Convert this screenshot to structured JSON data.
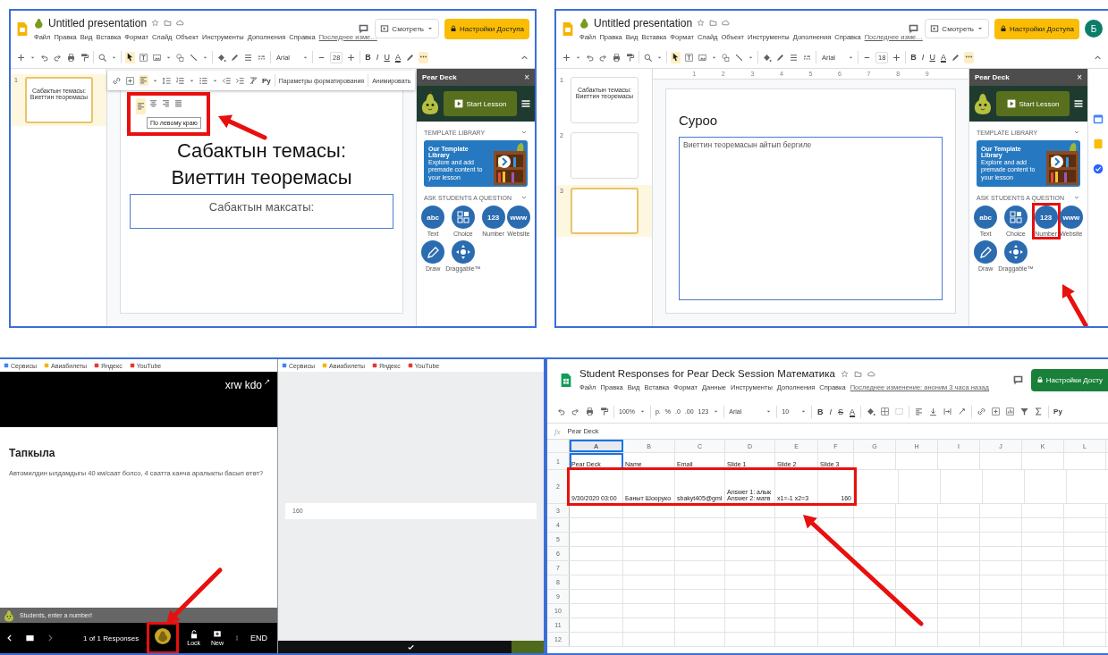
{
  "panels": [
    {
      "kind": "slides",
      "title": "Untitled presentation",
      "menu": [
        "Файл",
        "Правка",
        "Вид",
        "Вставка",
        "Формат",
        "Слайд",
        "Объект",
        "Инструменты",
        "Дополнения",
        "Справка"
      ],
      "last_edit": "Последнее изме…",
      "present_button": "Смотреть",
      "share_button": "Настройки Доступа",
      "font": "Arial",
      "font_size": "28",
      "format_buttons": [
        "B",
        "I",
        "U",
        "A"
      ],
      "format_bar": {
        "input_tools": "Py",
        "options": "Параметры форматирования",
        "animate": "Анимировать"
      },
      "align_menu": {
        "tooltip": "По левому краю",
        "highlighted": true
      },
      "addon_strip": false,
      "thumbnails": [
        {
          "number": "1",
          "text": "Сабактын темасы:\nВиеттин теоремасы",
          "selected": true
        }
      ],
      "slide": {
        "kind": "title",
        "title": "Сабактын темасы:\nВиеттин теоремасы",
        "body": "Сабактын максаты:"
      },
      "peardeck": {
        "title": "Pear Deck",
        "close": "×",
        "start": "Start Lesson",
        "library_heading": "TEMPLATE LIBRARY",
        "library_title": "Our Template Library",
        "library_text": "Explore and add premade content to your lesson",
        "ask_heading": "ASK STUDENTS A QUESTION",
        "question_types": [
          {
            "kind": "glyph",
            "glyph": "abc",
            "label": "Text",
            "highlighted": false
          },
          {
            "kind": "grid",
            "label": "Choice",
            "highlighted": false
          },
          {
            "kind": "glyph",
            "glyph": "123",
            "label": "Number",
            "highlighted": false
          },
          {
            "kind": "glyph",
            "glyph": "www",
            "label": "Website",
            "highlighted": false
          },
          {
            "kind": "pencil",
            "label": "Draw",
            "highlighted": false
          },
          {
            "kind": "move",
            "label": "Draggable™",
            "highlighted": false
          }
        ]
      }
    },
    {
      "kind": "slides",
      "title": "Untitled presentation",
      "menu": [
        "Файл",
        "Правка",
        "Вид",
        "Вставка",
        "Формат",
        "Слайд",
        "Объект",
        "Инструменты",
        "Дополнения",
        "Справка"
      ],
      "last_edit": "Последнее изме…",
      "present_button": "Смотреть",
      "share_button": "Настройки Доступа",
      "avatar": "Б",
      "font": "Arial",
      "font_size": "18",
      "format_buttons": [
        "B",
        "I",
        "U",
        "A"
      ],
      "ruler": [
        "1",
        "2",
        "3",
        "4",
        "5",
        "6",
        "7",
        "8",
        "9"
      ],
      "addon_strip": true,
      "thumbnails": [
        {
          "number": "1",
          "text": "Сабактын темасы:\nВиеттин теоремасы",
          "selected": false
        },
        {
          "number": "2",
          "selected": false
        },
        {
          "number": "3",
          "selected": true
        }
      ],
      "slide": {
        "kind": "question",
        "title": "Суроо",
        "body": "Виеттин теоремасын айтып бергиле"
      },
      "peardeck": {
        "title": "Pear Deck",
        "close": "×",
        "start": "Start Lesson",
        "library_heading": "TEMPLATE LIBRARY",
        "library_title": "Our Template Library",
        "library_text": "Explore and add premade content to your lesson",
        "ask_heading": "ASK STUDENTS A QUESTION",
        "question_types": [
          {
            "kind": "glyph",
            "glyph": "abc",
            "label": "Text",
            "highlighted": false
          },
          {
            "kind": "grid",
            "label": "Choice",
            "highlighted": false
          },
          {
            "kind": "glyph",
            "glyph": "123",
            "label": "Number",
            "highlighted": true
          },
          {
            "kind": "glyph",
            "glyph": "www",
            "label": "Website",
            "highlighted": false
          },
          {
            "kind": "pencil",
            "label": "Draw",
            "highlighted": false
          },
          {
            "kind": "move",
            "label": "Draggable™",
            "highlighted": false
          }
        ]
      }
    },
    {
      "kind": "presenter",
      "bookmarks": [
        "Сервисы",
        "Авиабилеты",
        "Яндекс",
        "YouTube"
      ],
      "session_code": "xrw kdo",
      "slide_title": "Тапкыла",
      "question": "Автомилдин ылдамдыгы 40 км/саат болсо, 4 саатта канча аралыкты басып өтөт?",
      "prompt_bar": "Students, enter a number!",
      "responses": "1 of 1 Responses",
      "deck_button_highlighted": true,
      "lock": "Lock",
      "new": "New",
      "end": "END",
      "student_bookmarks": [
        "Сервисы",
        "Авиабилеты",
        "Яндекс",
        "YouTube"
      ],
      "student_answer": "160"
    },
    {
      "kind": "sheet",
      "title": "Student Responses for Pear Deck Session Математика",
      "menu": [
        "Файл",
        "Правка",
        "Вид",
        "Вставка",
        "Формат",
        "Данные",
        "Инструменты",
        "Дополнения",
        "Справка"
      ],
      "last_edit": "Последнее изменение: аноним 3 часа назад",
      "share_button": "Настройки Досту",
      "toolbar": {
        "zoom": "100%",
        "number_formats": [
          "р.",
          "%",
          ".0",
          ".00",
          "123"
        ],
        "font": "Arial",
        "font_size": "10",
        "format_buttons": [
          "B",
          "I",
          "S",
          "A"
        ],
        "input_tools": "Py"
      },
      "formula_label": "fx",
      "formula": "Pear Deck",
      "columns": [
        {
          "label": "A",
          "selected": true
        },
        {
          "label": "B",
          "selected": false
        },
        {
          "label": "C",
          "selected": false
        },
        {
          "label": "D",
          "selected": false
        },
        {
          "label": "E",
          "selected": false
        },
        {
          "label": "F",
          "selected": false
        },
        {
          "label": "G",
          "selected": false
        },
        {
          "label": "H",
          "selected": false
        },
        {
          "label": "I",
          "selected": false
        },
        {
          "label": "J",
          "selected": false
        },
        {
          "label": "K",
          "selected": false
        },
        {
          "label": "L",
          "selected": false
        }
      ],
      "rows": [
        {
          "number": "1",
          "highlighted": false,
          "cells": [
            {
              "text": "Pear Deck",
              "kind": "text",
              "selected": true
            },
            {
              "text": "Name",
              "kind": "text",
              "selected": false
            },
            {
              "text": "Email",
              "kind": "text",
              "selected": false
            },
            {
              "text": "Slide 1",
              "kind": "text",
              "selected": false
            },
            {
              "text": "Slide 2",
              "kind": "text",
              "selected": false
            },
            {
              "text": "Slide 3",
              "kind": "text",
              "selected": false
            }
          ]
        },
        {
          "number": "2",
          "highlighted": true,
          "cells": [
            {
              "text": "9/30/2020 03:00",
              "kind": "text",
              "selected": false
            },
            {
              "text": "Баныт Шооруко",
              "kind": "text",
              "selected": false
            },
            {
              "text": "sbakyt405@gmi",
              "kind": "text",
              "selected": false
            },
            {
              "text": "Answer 1: алык\nAnswer 2: матв",
              "kind": "text",
              "selected": false
            },
            {
              "text": "x1=-1 x2=3",
              "kind": "text",
              "selected": false
            },
            {
              "text": "160",
              "kind": "number",
              "selected": false
            }
          ]
        },
        {
          "number": "3",
          "highlighted": false
        },
        {
          "number": "4",
          "highlighted": false
        },
        {
          "number": "5",
          "highlighted": false
        },
        {
          "number": "6",
          "highlighted": false
        },
        {
          "number": "7",
          "highlighted": false
        },
        {
          "number": "8",
          "highlighted": false
        },
        {
          "number": "9",
          "highlighted": false
        },
        {
          "number": "10",
          "highlighted": false
        },
        {
          "number": "11",
          "highlighted": false
        },
        {
          "number": "12",
          "highlighted": false
        }
      ]
    }
  ]
}
